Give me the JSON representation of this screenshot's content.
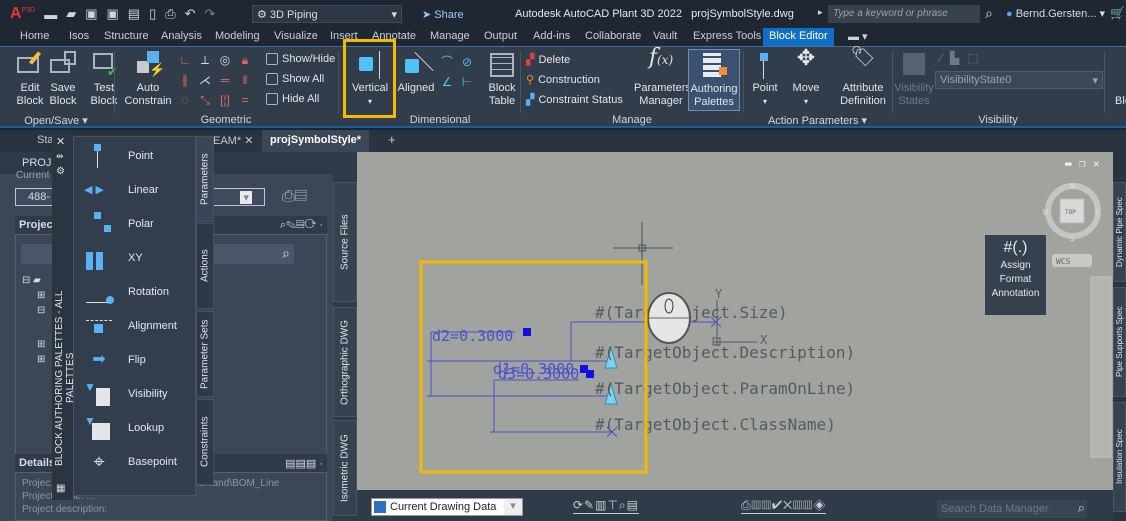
{
  "titlebar": {
    "app_badge": "P3D",
    "workspace": "3D Piping",
    "share": "Share",
    "title": "Autodesk AutoCAD Plant 3D 2022   projSymbolStyle.dwg",
    "search_placeholder": "Type a keyword or phrase",
    "user": "Bernd.Gersten..."
  },
  "ribbon_tabs": [
    "Home",
    "Isos",
    "Structure",
    "Analysis",
    "Modeling",
    "Visualize",
    "Insert",
    "Annotate",
    "Manage",
    "Output",
    "Add-ins",
    "Collaborate",
    "Vault",
    "Express Tools",
    "Block Editor"
  ],
  "active_tab": "Block Editor",
  "ribbon": {
    "open_save": {
      "title": "Open/Save",
      "edit_block": "Edit Block",
      "save_block": "Save Block",
      "test_block": "Test Block"
    },
    "geometric": {
      "title": "Geometric",
      "auto_constrain": "Auto Constrain",
      "show_hide": "Show/Hide",
      "show_all": "Show All",
      "hide_all": "Hide All"
    },
    "dimensional": {
      "title": "Dimensional",
      "vertical": "Vertical",
      "aligned": "Aligned",
      "block_table": "Block Table"
    },
    "manage": {
      "title": "Manage",
      "delete": "Delete",
      "construction": "Construction",
      "constraint_status": "Constraint Status",
      "parameters_manager": "Parameters Manager",
      "authoring_palettes": "Authoring Palettes"
    },
    "action_parameters": {
      "title": "Action Parameters",
      "point": "Point",
      "move": "Move",
      "attribute_definition": "Attribute Definition"
    },
    "visibility": {
      "title": "Visibility",
      "visibility_states": "Visibility States",
      "state": "VisibilityState0"
    },
    "extra": "Blo"
  },
  "doc_tabs": [
    "Sta",
    "EAM*",
    "projSymbolStyle*"
  ],
  "left_panel": {
    "title": "PROJE",
    "current": "Current",
    "project_value": "488-",
    "project_label": "Project",
    "details": "Details",
    "details_lines": [
      "Projec...                                   en\\Griechenland\\BOM_Line",
      "Project name: ...",
      "Project description:"
    ]
  },
  "side_tabs": [
    "Source Files",
    "Orthographic DWG",
    "Isometric DWG"
  ],
  "palette": {
    "title": "BLOCK AUTHORING PALETTES - ALL PALETTES",
    "items": [
      "Point",
      "Linear",
      "Polar",
      "XY",
      "Rotation",
      "Alignment",
      "Flip",
      "Visibility",
      "Lookup",
      "Basepoint"
    ],
    "tabs": [
      "Parameters",
      "Actions",
      "Parameter Sets",
      "Constraints"
    ]
  },
  "drawing": {
    "dims": [
      "d2=0.3000",
      "d1=0.3000",
      "d3=0.3000"
    ],
    "attrs": [
      "#(TargetObject.Size)",
      "#(TargetObject.Description)",
      "#(TargetObject.ParamOnLine)",
      "#(TargetObject.ClassName)"
    ],
    "axis_x": "X",
    "axis_y": "Y"
  },
  "viewcube": {
    "n": "N",
    "s": "S",
    "e": "E",
    "w": "W",
    "top": "TOP",
    "wcs": "WCS"
  },
  "assign_button": {
    "symbol": "#(.)",
    "label1": "Assign",
    "label2": "Format",
    "label3": "Annotation"
  },
  "right_tabs": [
    "Dynamic Pipe Spec",
    "Pipe Supports Spec",
    "Insulation Spec"
  ],
  "bottom": {
    "data_source": "Current Drawing Data",
    "search_placeholder": "Search Data Manager"
  },
  "colors": {
    "accent": "#0f6fc6",
    "highlight": "#f6b800",
    "dim": "#3a3ad8",
    "canvas": "#a1a39f"
  }
}
